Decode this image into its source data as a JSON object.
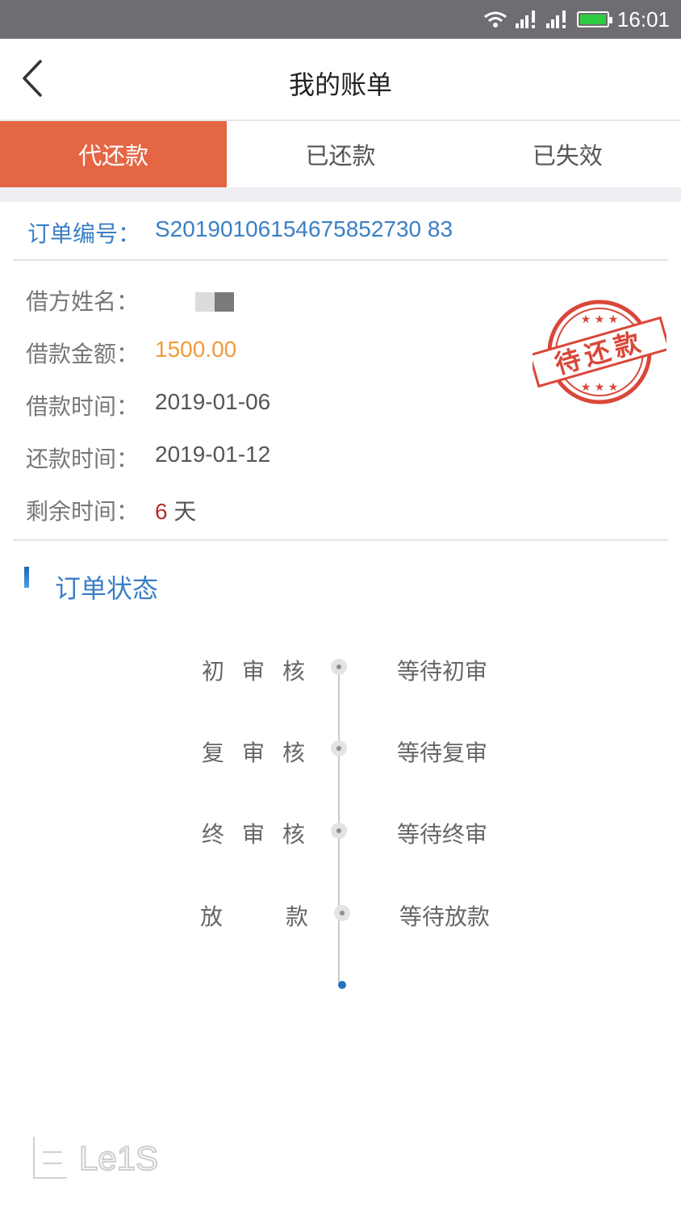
{
  "status_bar": {
    "time": "16:01",
    "icons": [
      "wifi-icon",
      "signal-icon",
      "signal-icon",
      "battery-icon"
    ],
    "battery_color": "#2ecc40",
    "background": "#6e6d72"
  },
  "header": {
    "title": "我的账单",
    "back_icon": "chevron-left-icon"
  },
  "tabs": {
    "items": [
      {
        "label": "代还款",
        "active": true
      },
      {
        "label": "已还款",
        "active": false
      },
      {
        "label": "已失效",
        "active": false
      }
    ],
    "active_color": "#e56644"
  },
  "order": {
    "number_label": "订单编号：",
    "number_value": "S20190106154675852730 83"
  },
  "details": {
    "name_label": "借方姓名：",
    "name_value": "",
    "amount_label": "借款金额：",
    "amount_value": "1500.00",
    "loan_time_label": "借款时间：",
    "loan_time_value": "2019-01-06",
    "repay_time_label": "还款时间：",
    "repay_time_value": "2019-01-12",
    "remaining_label": "剩余时间：",
    "remaining_number": "6",
    "remaining_unit": " 天",
    "stamp_text": "待还款",
    "stamp_color": "#d9473a"
  },
  "order_status": {
    "title": "订单状态",
    "steps": [
      {
        "name": "初审核",
        "status": "等待初审"
      },
      {
        "name": "复审核",
        "status": "等待复审"
      },
      {
        "name": "终审核",
        "status": "等待终审"
      },
      {
        "name": "放款",
        "status": "等待放款"
      }
    ]
  },
  "watermark": {
    "text": "Le1S"
  }
}
